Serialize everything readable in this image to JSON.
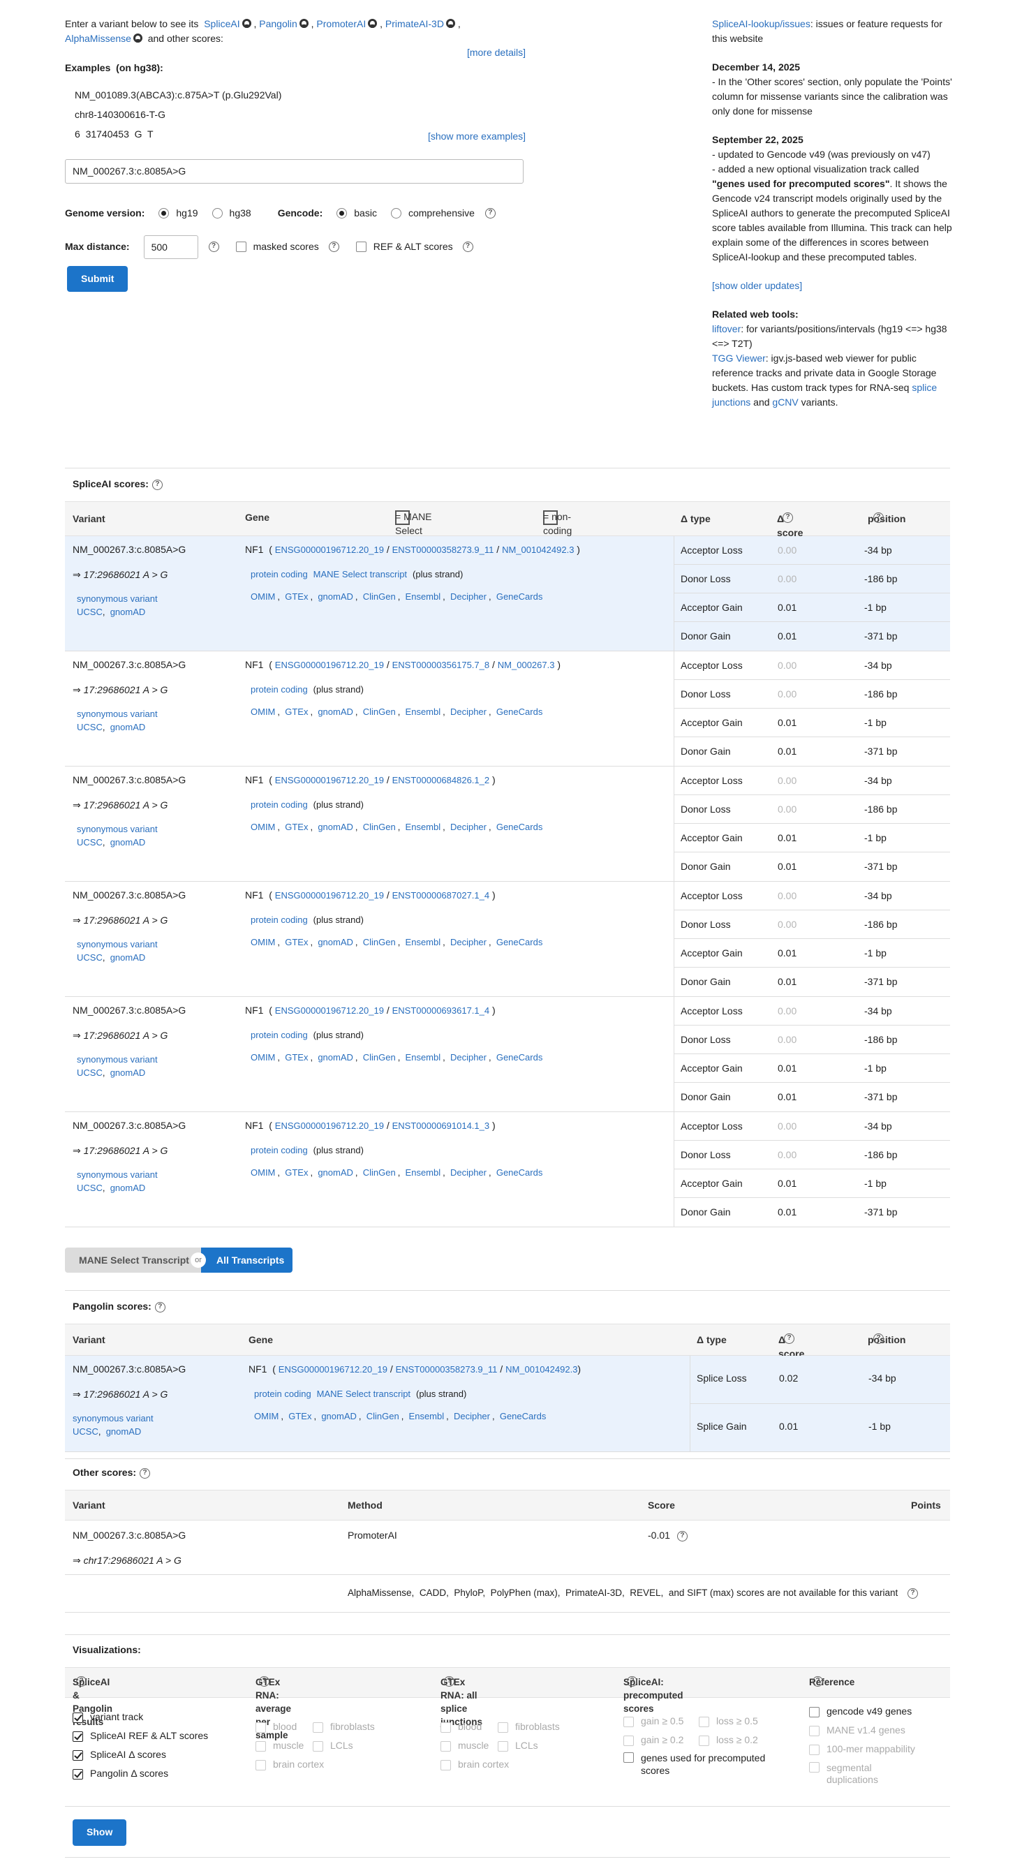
{
  "intro": {
    "text_before": "Enter a variant below to see its",
    "tools": [
      "SpliceAI",
      "Pangolin",
      "PromoterAI",
      "PrimateAI-3D",
      "AlphaMissense"
    ],
    "text_after": "and other scores:",
    "more_details": "[more details]"
  },
  "examples": {
    "title": "Examples",
    "build": "(on hg38):",
    "items": [
      "NM_001089.3(ABCA3):c.875A>T (p.Glu292Val)",
      "chr8-140300616-T-G",
      "6  31740453  G  T"
    ],
    "show_more": "[show more examples]"
  },
  "query": {
    "value": "NM_000267.3:c.8085A>G"
  },
  "options": {
    "genome_label": "Genome version:",
    "genome_opts": [
      "hg19",
      "hg38"
    ],
    "gencode_label": "Gencode:",
    "gencode_opts": [
      "basic",
      "comprehensive"
    ],
    "maxdist_label": "Max distance:",
    "maxdist_value": "500",
    "masked_label": "masked scores",
    "refalt_label": "REF & ALT scores",
    "submit": "Submit"
  },
  "news": {
    "issues_link": "SpliceAI-lookup/issues",
    "issues_text": ": issues or feature requests for this website",
    "d1": "December 14, 2025",
    "d1_text": "- In the 'Other scores' section, only populate the 'Points' column for missense variants since the calibration was only done for missense",
    "d2": "September 22, 2025",
    "d2_l1": "- updated to Gencode v49 (was previously on v47)",
    "d2_l2a": "- added a new optional visualization track called",
    "d2_bold": "\"genes used for precomputed scores\"",
    "d2_l2b": ". It shows the Gencode v24 transcript models originally used by the SpliceAI authors to generate the precomputed SpliceAI score tables available from Illumina. This track can help explain some of the differences in scores between SpliceAI-lookup and these precomputed tables.",
    "older": "[show older updates]",
    "related_title": "Related web tools:",
    "liftover": "liftover",
    "liftover_text": ": for variants/positions/intervals (hg19 <=> hg38 <=> T2T)",
    "tgg": "TGG Viewer",
    "tgg_text": ": igv.js-based web viewer for public reference tracks and private data in Google Storage buckets. Has custom track types for RNA-seq",
    "splice_junctions": "splice junctions",
    "and": "and",
    "gcnv": "gCNV",
    "variants": "variants."
  },
  "spliceai": {
    "title": "SpliceAI scores:",
    "headers": {
      "variant": "Variant",
      "gene": "Gene",
      "mane_legend": "= MANE Select transcript",
      "noncoding_legend": "= non-coding transcript",
      "dtype": "Δ type",
      "dscore": "Δ score",
      "position": "position"
    },
    "rows": [
      {
        "variant": "NM_000267.3:c.8085A>G",
        "pos": "⇒ 17:29686021 A > G",
        "conseq": "synonymous variant",
        "gene": "NF1",
        "ensg": "ENSG00000196712.20_19",
        "enst": "ENST00000358273.9_11",
        "nm": "NM_001042492.3",
        "biotype": "protein coding",
        "mane": "MANE Select transcript",
        "strand": "(plus strand)",
        "highlight": true
      },
      {
        "variant": "NM_000267.3:c.8085A>G",
        "pos": "⇒ 17:29686021 A > G",
        "conseq": "synonymous variant",
        "gene": "NF1",
        "ensg": "ENSG00000196712.20_19",
        "enst": "ENST00000356175.7_8",
        "nm": "NM_000267.3",
        "biotype": "protein coding",
        "mane": "",
        "strand": "(plus strand)",
        "highlight": false
      },
      {
        "variant": "NM_000267.3:c.8085A>G",
        "pos": "⇒ 17:29686021 A > G",
        "conseq": "synonymous variant",
        "gene": "NF1",
        "ensg": "ENSG00000196712.20_19",
        "enst": "ENST00000684826.1_2",
        "nm": "",
        "biotype": "protein coding",
        "mane": "",
        "strand": "(plus strand)",
        "highlight": false
      },
      {
        "variant": "NM_000267.3:c.8085A>G",
        "pos": "⇒ 17:29686021 A > G",
        "conseq": "synonymous variant",
        "gene": "NF1",
        "ensg": "ENSG00000196712.20_19",
        "enst": "ENST00000687027.1_4",
        "nm": "",
        "biotype": "protein coding",
        "mane": "",
        "strand": "(plus strand)",
        "highlight": false
      },
      {
        "variant": "NM_000267.3:c.8085A>G",
        "pos": "⇒ 17:29686021 A > G",
        "conseq": "synonymous variant",
        "gene": "NF1",
        "ensg": "ENSG00000196712.20_19",
        "enst": "ENST00000693617.1_4",
        "nm": "",
        "biotype": "protein coding",
        "mane": "",
        "strand": "(plus strand)",
        "highlight": false
      },
      {
        "variant": "NM_000267.3:c.8085A>G",
        "pos": "⇒ 17:29686021 A > G",
        "conseq": "synonymous variant",
        "gene": "NF1",
        "ensg": "ENSG00000196712.20_19",
        "enst": "ENST00000691014.1_3",
        "nm": "",
        "biotype": "protein coding",
        "mane": "",
        "strand": "(plus strand)",
        "highlight": false
      }
    ],
    "links": [
      "UCSC",
      "gnomAD"
    ],
    "gene_links": [
      "OMIM",
      "GTEx",
      "gnomAD",
      "ClinGen",
      "Ensembl",
      "Decipher",
      "GeneCards"
    ],
    "scores": [
      {
        "type": "Acceptor Loss",
        "score": "0.00",
        "pos": "-34 bp"
      },
      {
        "type": "Donor Loss",
        "score": "0.00",
        "pos": "-186 bp"
      },
      {
        "type": "Acceptor Gain",
        "score": "0.01",
        "pos": "-1 bp"
      },
      {
        "type": "Donor Gain",
        "score": "0.01",
        "pos": "-371 bp"
      }
    ]
  },
  "toggle": {
    "a": "MANE Select Transcript",
    "or": "or",
    "b": "All Transcripts"
  },
  "pangolin": {
    "title": "Pangolin scores:",
    "headers": {
      "variant": "Variant",
      "gene": "Gene",
      "dtype": "Δ type",
      "dscore": "Δ score",
      "position": "position"
    },
    "scores": [
      {
        "type": "Splice Loss",
        "score": "0.02",
        "pos": "-34 bp"
      },
      {
        "type": "Splice Gain",
        "score": "0.01",
        "pos": "-1 bp"
      }
    ]
  },
  "other": {
    "title": "Other scores:",
    "headers": {
      "variant": "Variant",
      "method": "Method",
      "score": "Score",
      "points": "Points"
    },
    "variant": "NM_000267.3:c.8085A>G",
    "pos": "⇒ chr17:29686021 A > G",
    "method": "PromoterAI",
    "score": "-0.01",
    "na_list": [
      "AlphaMissense",
      "CADD",
      "PhyloP",
      "PolyPhen (max)",
      "PrimateAI-3D",
      "REVEL"
    ],
    "na_and": "and",
    "na_last": "SIFT (max)",
    "na_text": "scores are not available for this variant"
  },
  "viz": {
    "title": "Visualizations:",
    "c1_title": "SpliceAI & Pangolin results",
    "c1_items": [
      "variant track",
      "SpliceAI REF & ALT scores",
      "SpliceAI Δ scores",
      "Pangolin Δ scores"
    ],
    "c2_title": "GTEx RNA: average per sample",
    "c3_title": "GTEx RNA: all splice junctions",
    "tissues": [
      "blood",
      "fibroblasts",
      "muscle",
      "LCLs",
      "brain cortex"
    ],
    "c4_title": "SpliceAI: precomputed scores",
    "c4_items": [
      "gain ≥ 0.5",
      "loss ≥ 0.5",
      "gain ≥ 0.2",
      "loss ≥ 0.2"
    ],
    "c4_genes": "genes used for precomputed scores",
    "c5_title": "Reference",
    "c5_items": [
      "gencode v49 genes",
      "MANE v1.4 genes",
      "100-mer mappability",
      "segmental duplications"
    ],
    "show": "Show"
  }
}
